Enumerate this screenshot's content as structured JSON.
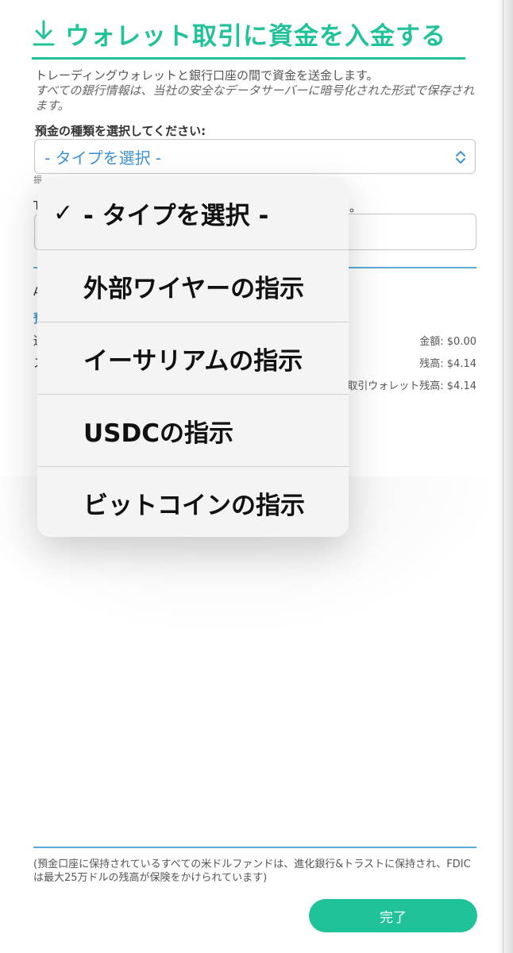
{
  "header": {
    "title": "ウォレット取引に資金を入金する",
    "download_icon": "download-icon"
  },
  "description": {
    "line1": "トレーディングウォレットと銀行口座の間で資金を送金します。",
    "line2": "すべての銀行情報は、当社の安全なデータサーバーに暗号化された形式で保存されます。"
  },
  "deposit_type": {
    "label": "預金の種類を選択してください:",
    "selected": "- タイプを選択 -",
    "arrow_icon": "chevron-up-down-icon"
  },
  "obscured": {
    "small_under_select": "振",
    "label_partial": "T",
    "label_end": "。",
    "row_a": "A",
    "row_blue": "預",
    "row_3": "通",
    "row_4": "ス"
  },
  "amounts": {
    "amount": "金額: $0.00",
    "balance": "残高: $4.14",
    "wallet_balance": "取引ウォレット残高: $4.14"
  },
  "dropdown": {
    "options": [
      {
        "label": "- タイプを選択 -",
        "checked": true
      },
      {
        "label": "外部ワイヤーの指示",
        "checked": false
      },
      {
        "label": "イーサリアムの指示",
        "checked": false
      },
      {
        "label": "USDCの指示",
        "checked": false
      },
      {
        "label": "ビットコインの指示",
        "checked": false
      }
    ],
    "check_icon": "checkmark-icon"
  },
  "footer": {
    "note": "(預金口座に保持されているすべての米ドルファンドは、進化銀行&トラストに保持され、FDICは最大25万ドルの残高が保険をかけられています)",
    "done_label": "完了"
  },
  "colors": {
    "accent": "#20c29a",
    "link_blue": "#3e93d6",
    "rule_blue": "#5aaad8"
  }
}
